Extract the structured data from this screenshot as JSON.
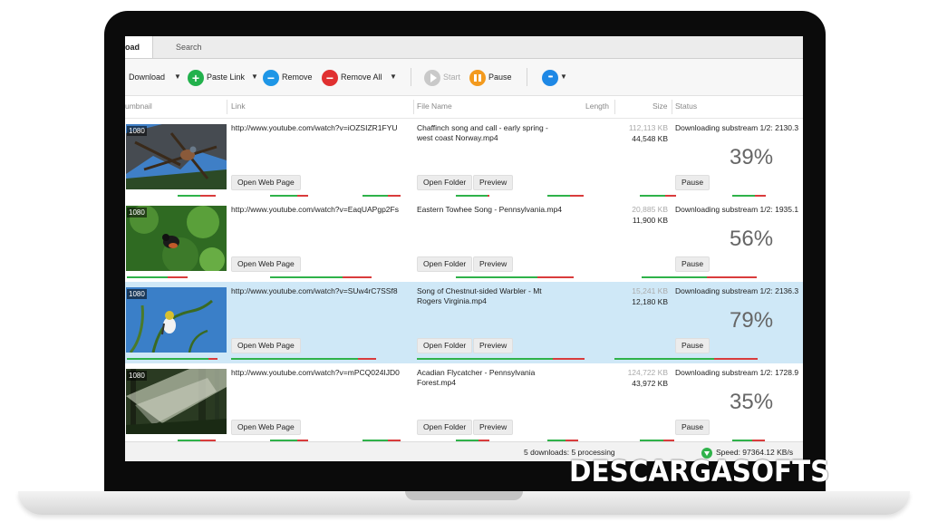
{
  "tabs": [
    "oad",
    "Search"
  ],
  "toolbar": {
    "download": "Download",
    "paste_link": "Paste Link",
    "remove": "Remove",
    "remove_all": "Remove All",
    "start": "Start",
    "pause": "Pause",
    "more": "•••"
  },
  "columns": {
    "thumbnail": "umbnail",
    "link": "Link",
    "file_name": "File Name",
    "length": "Length",
    "size": "Size",
    "status": "Status"
  },
  "rows": [
    {
      "res": "1080",
      "link": "http://www.youtube.com/watch?v=iOZSIZR1FYU",
      "file": "Chaffinch song and call - early spring - west coast Norway.mp4",
      "size_total": "112,113 KB",
      "size_done": "44,548 KB",
      "status": "Downloading substream 1/2: 2130.3",
      "percent": "39%",
      "progress": 0.39
    },
    {
      "res": "1080",
      "link": "http://www.youtube.com/watch?v=EaqUAPgp2Fs",
      "file": "Eastern Towhee Song - Pennsylvania.mp4",
      "size_total": "20,885 KB",
      "size_done": "11,900 KB",
      "status": "Downloading substream 1/2: 1935.1",
      "percent": "56%",
      "progress": 0.56
    },
    {
      "res": "1080",
      "link": "http://www.youtube.com/watch?v=SUw4rC7SSf8",
      "file": "Song of Chestnut-sided Warbler - Mt Rogers Virginia.mp4",
      "size_total": "15,241 KB",
      "size_done": "12,180 KB",
      "status": "Downloading substream 1/2: 2136.3",
      "percent": "79%",
      "progress": 0.79
    },
    {
      "res": "1080",
      "link": "http://www.youtube.com/watch?v=mPCQ024IJD0",
      "file": "Acadian Flycatcher - Pennsylvania Forest.mp4",
      "size_total": "124,722 KB",
      "size_done": "43,972 KB",
      "status": "Downloading substream 1/2: 1728.9",
      "percent": "35%",
      "progress": 0.35
    }
  ],
  "buttons": {
    "open_web_page": "Open Web Page",
    "open_folder": "Open Folder",
    "preview": "Preview",
    "pause": "Pause"
  },
  "statusbar": {
    "downloads": "5 downloads: 5 processing",
    "speed": "Speed: 97364.12 KB/s"
  },
  "watermark": "DESCARGASOFTS",
  "colors": {
    "selected_row": "#cfe8f7",
    "paste_green": "#22b14c",
    "remove_blue": "#1e96e6",
    "remove_all_red": "#e03030",
    "pause_orange": "#f39a1e",
    "more_blue": "#1e88e5"
  },
  "icons": [
    "plus-icon",
    "minus-icon",
    "play-icon",
    "pause-icon",
    "more-icon",
    "download-arrow-icon"
  ]
}
